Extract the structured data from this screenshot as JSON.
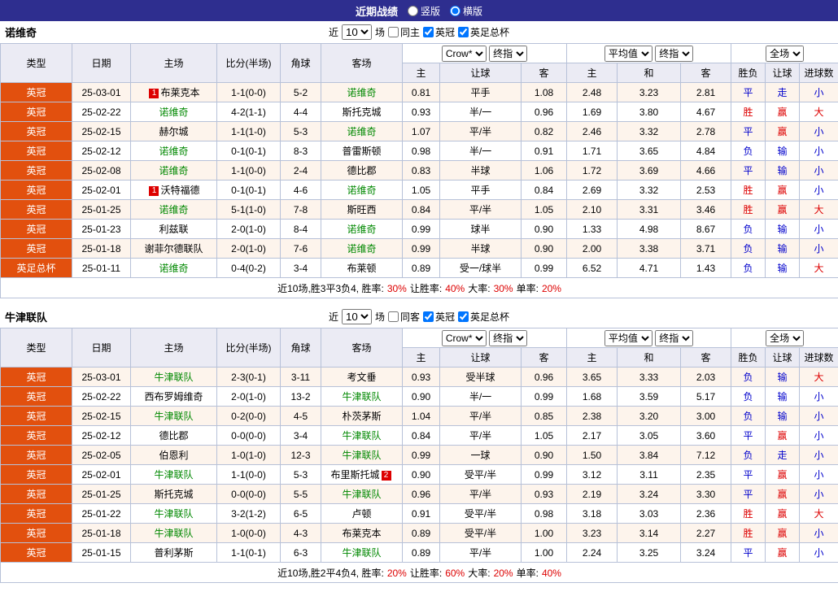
{
  "colors": {
    "header_bar": "#2e2e8f",
    "type_cell": "#e2500e",
    "team_highlight": "#008800",
    "result_red": "#dd0000",
    "result_blue": "#0000cc"
  },
  "topbar": {
    "title": "近期战绩",
    "radio_vertical": "竖版",
    "radio_horizontal": "横版",
    "horizontal_selected": true
  },
  "sections": [
    {
      "team": "诺维奇",
      "filter": {
        "prefix": "近",
        "count": "10",
        "suffix": "场",
        "same_label": "同主",
        "same_checked": false,
        "league1": "英冠",
        "league1_checked": true,
        "league2": "英足总杯",
        "league2_checked": true
      },
      "columns": {
        "type": "类型",
        "date": "日期",
        "home": "主场",
        "score": "比分(半场)",
        "corner": "角球",
        "away": "客场",
        "odds_select1": "Crow*",
        "odds_select2": "终指",
        "avg_select1": "平均值",
        "avg_select2": "终指",
        "full_select": "全场",
        "odds_home": "主",
        "odds_handicap": "让球",
        "odds_away": "客",
        "avg_home": "主",
        "avg_draw": "和",
        "avg_away": "客",
        "result": "胜负",
        "handicap_result": "让球",
        "goals": "进球数"
      },
      "rows": [
        {
          "type": "英冠",
          "date": "25-03-01",
          "home": "布莱克本",
          "home_badge": "1",
          "home_is_team": false,
          "score": "1-1(0-0)",
          "corner": "5-2",
          "away": "诺维奇",
          "away_badge": "",
          "away_is_team": true,
          "odds": [
            "0.81",
            "平手",
            "1.08"
          ],
          "avg": [
            "2.48",
            "3.23",
            "2.81"
          ],
          "results": [
            "平",
            "走",
            "小"
          ]
        },
        {
          "type": "英冠",
          "date": "25-02-22",
          "home": "诺维奇",
          "home_badge": "",
          "home_is_team": true,
          "score": "4-2(1-1)",
          "corner": "4-4",
          "away": "斯托克城",
          "away_badge": "",
          "away_is_team": false,
          "odds": [
            "0.93",
            "半/一",
            "0.96"
          ],
          "avg": [
            "1.69",
            "3.80",
            "4.67"
          ],
          "results": [
            "胜",
            "赢",
            "大"
          ]
        },
        {
          "type": "英冠",
          "date": "25-02-15",
          "home": "赫尔城",
          "home_badge": "",
          "home_is_team": false,
          "score": "1-1(1-0)",
          "corner": "5-3",
          "away": "诺维奇",
          "away_badge": "",
          "away_is_team": true,
          "odds": [
            "1.07",
            "平/半",
            "0.82"
          ],
          "avg": [
            "2.46",
            "3.32",
            "2.78"
          ],
          "results": [
            "平",
            "赢",
            "小"
          ]
        },
        {
          "type": "英冠",
          "date": "25-02-12",
          "home": "诺维奇",
          "home_badge": "",
          "home_is_team": true,
          "score": "0-1(0-1)",
          "corner": "8-3",
          "away": "普雷斯顿",
          "away_badge": "",
          "away_is_team": false,
          "odds": [
            "0.98",
            "半/一",
            "0.91"
          ],
          "avg": [
            "1.71",
            "3.65",
            "4.84"
          ],
          "results": [
            "负",
            "输",
            "小"
          ]
        },
        {
          "type": "英冠",
          "date": "25-02-08",
          "home": "诺维奇",
          "home_badge": "",
          "home_is_team": true,
          "score": "1-1(0-0)",
          "corner": "2-4",
          "away": "德比郡",
          "away_badge": "",
          "away_is_team": false,
          "odds": [
            "0.83",
            "半球",
            "1.06"
          ],
          "avg": [
            "1.72",
            "3.69",
            "4.66"
          ],
          "results": [
            "平",
            "输",
            "小"
          ]
        },
        {
          "type": "英冠",
          "date": "25-02-01",
          "home": "沃特福德",
          "home_badge": "1",
          "home_is_team": false,
          "score": "0-1(0-1)",
          "corner": "4-6",
          "away": "诺维奇",
          "away_badge": "",
          "away_is_team": true,
          "odds": [
            "1.05",
            "平手",
            "0.84"
          ],
          "avg": [
            "2.69",
            "3.32",
            "2.53"
          ],
          "results": [
            "胜",
            "赢",
            "小"
          ]
        },
        {
          "type": "英冠",
          "date": "25-01-25",
          "home": "诺维奇",
          "home_badge": "",
          "home_is_team": true,
          "score": "5-1(1-0)",
          "corner": "7-8",
          "away": "斯旺西",
          "away_badge": "",
          "away_is_team": false,
          "odds": [
            "0.84",
            "平/半",
            "1.05"
          ],
          "avg": [
            "2.10",
            "3.31",
            "3.46"
          ],
          "results": [
            "胜",
            "赢",
            "大"
          ]
        },
        {
          "type": "英冠",
          "date": "25-01-23",
          "home": "利兹联",
          "home_badge": "",
          "home_is_team": false,
          "score": "2-0(1-0)",
          "corner": "8-4",
          "away": "诺维奇",
          "away_badge": "",
          "away_is_team": true,
          "odds": [
            "0.99",
            "球半",
            "0.90"
          ],
          "avg": [
            "1.33",
            "4.98",
            "8.67"
          ],
          "results": [
            "负",
            "输",
            "小"
          ]
        },
        {
          "type": "英冠",
          "date": "25-01-18",
          "home": "谢菲尔德联队",
          "home_badge": "",
          "home_is_team": false,
          "score": "2-0(1-0)",
          "corner": "7-6",
          "away": "诺维奇",
          "away_badge": "",
          "away_is_team": true,
          "odds": [
            "0.99",
            "半球",
            "0.90"
          ],
          "avg": [
            "2.00",
            "3.38",
            "3.71"
          ],
          "results": [
            "负",
            "输",
            "小"
          ]
        },
        {
          "type": "英足总杯",
          "date": "25-01-11",
          "home": "诺维奇",
          "home_badge": "",
          "home_is_team": true,
          "score": "0-4(0-2)",
          "corner": "3-4",
          "away": "布莱顿",
          "away_badge": "",
          "away_is_team": false,
          "odds": [
            "0.89",
            "受一/球半",
            "0.99"
          ],
          "avg": [
            "6.52",
            "4.71",
            "1.43"
          ],
          "results": [
            "负",
            "输",
            "大"
          ]
        }
      ],
      "summary": [
        {
          "text": "近10场,胜3平3负4, 胜率:",
          "red": false
        },
        {
          "text": "30%",
          "red": true
        },
        {
          "text": "让胜率:",
          "red": false
        },
        {
          "text": "40%",
          "red": true
        },
        {
          "text": "大率:",
          "red": false
        },
        {
          "text": "30%",
          "red": true
        },
        {
          "text": "单率:",
          "red": false
        },
        {
          "text": "20%",
          "red": true
        }
      ]
    },
    {
      "team": "牛津联队",
      "filter": {
        "prefix": "近",
        "count": "10",
        "suffix": "场",
        "same_label": "同客",
        "same_checked": false,
        "league1": "英冠",
        "league1_checked": true,
        "league2": "英足总杯",
        "league2_checked": true
      },
      "columns": {
        "type": "类型",
        "date": "日期",
        "home": "主场",
        "score": "比分(半场)",
        "corner": "角球",
        "away": "客场",
        "odds_select1": "Crow*",
        "odds_select2": "终指",
        "avg_select1": "平均值",
        "avg_select2": "终指",
        "full_select": "全场",
        "odds_home": "主",
        "odds_handicap": "让球",
        "odds_away": "客",
        "avg_home": "主",
        "avg_draw": "和",
        "avg_away": "客",
        "result": "胜负",
        "handicap_result": "让球",
        "goals": "进球数"
      },
      "rows": [
        {
          "type": "英冠",
          "date": "25-03-01",
          "home": "牛津联队",
          "home_badge": "",
          "home_is_team": true,
          "score": "2-3(0-1)",
          "corner": "3-11",
          "away": "考文垂",
          "away_badge": "",
          "away_is_team": false,
          "odds": [
            "0.93",
            "受半球",
            "0.96"
          ],
          "avg": [
            "3.65",
            "3.33",
            "2.03"
          ],
          "results": [
            "负",
            "输",
            "大"
          ]
        },
        {
          "type": "英冠",
          "date": "25-02-22",
          "home": "西布罗姆维奇",
          "home_badge": "",
          "home_is_team": false,
          "score": "2-0(1-0)",
          "corner": "13-2",
          "away": "牛津联队",
          "away_badge": "",
          "away_is_team": true,
          "odds": [
            "0.90",
            "半/一",
            "0.99"
          ],
          "avg": [
            "1.68",
            "3.59",
            "5.17"
          ],
          "results": [
            "负",
            "输",
            "小"
          ]
        },
        {
          "type": "英冠",
          "date": "25-02-15",
          "home": "牛津联队",
          "home_badge": "",
          "home_is_team": true,
          "score": "0-2(0-0)",
          "corner": "4-5",
          "away": "朴茨茅斯",
          "away_badge": "",
          "away_is_team": false,
          "odds": [
            "1.04",
            "平/半",
            "0.85"
          ],
          "avg": [
            "2.38",
            "3.20",
            "3.00"
          ],
          "results": [
            "负",
            "输",
            "小"
          ]
        },
        {
          "type": "英冠",
          "date": "25-02-12",
          "home": "德比郡",
          "home_badge": "",
          "home_is_team": false,
          "score": "0-0(0-0)",
          "corner": "3-4",
          "away": "牛津联队",
          "away_badge": "",
          "away_is_team": true,
          "odds": [
            "0.84",
            "平/半",
            "1.05"
          ],
          "avg": [
            "2.17",
            "3.05",
            "3.60"
          ],
          "results": [
            "平",
            "赢",
            "小"
          ]
        },
        {
          "type": "英冠",
          "date": "25-02-05",
          "home": "伯恩利",
          "home_badge": "",
          "home_is_team": false,
          "score": "1-0(1-0)",
          "corner": "12-3",
          "away": "牛津联队",
          "away_badge": "",
          "away_is_team": true,
          "odds": [
            "0.99",
            "一球",
            "0.90"
          ],
          "avg": [
            "1.50",
            "3.84",
            "7.12"
          ],
          "results": [
            "负",
            "走",
            "小"
          ]
        },
        {
          "type": "英冠",
          "date": "25-02-01",
          "home": "牛津联队",
          "home_badge": "",
          "home_is_team": true,
          "score": "1-1(0-0)",
          "corner": "5-3",
          "away": "布里斯托城",
          "away_badge": "2",
          "away_is_team": false,
          "odds": [
            "0.90",
            "受平/半",
            "0.99"
          ],
          "avg": [
            "3.12",
            "3.11",
            "2.35"
          ],
          "results": [
            "平",
            "赢",
            "小"
          ]
        },
        {
          "type": "英冠",
          "date": "25-01-25",
          "home": "斯托克城",
          "home_badge": "",
          "home_is_team": false,
          "score": "0-0(0-0)",
          "corner": "5-5",
          "away": "牛津联队",
          "away_badge": "",
          "away_is_team": true,
          "odds": [
            "0.96",
            "平/半",
            "0.93"
          ],
          "avg": [
            "2.19",
            "3.24",
            "3.30"
          ],
          "results": [
            "平",
            "赢",
            "小"
          ]
        },
        {
          "type": "英冠",
          "date": "25-01-22",
          "home": "牛津联队",
          "home_badge": "",
          "home_is_team": true,
          "score": "3-2(1-2)",
          "corner": "6-5",
          "away": "卢顿",
          "away_badge": "",
          "away_is_team": false,
          "odds": [
            "0.91",
            "受平/半",
            "0.98"
          ],
          "avg": [
            "3.18",
            "3.03",
            "2.36"
          ],
          "results": [
            "胜",
            "赢",
            "大"
          ]
        },
        {
          "type": "英冠",
          "date": "25-01-18",
          "home": "牛津联队",
          "home_badge": "",
          "home_is_team": true,
          "score": "1-0(0-0)",
          "corner": "4-3",
          "away": "布莱克本",
          "away_badge": "",
          "away_is_team": false,
          "odds": [
            "0.89",
            "受平/半",
            "1.00"
          ],
          "avg": [
            "3.23",
            "3.14",
            "2.27"
          ],
          "results": [
            "胜",
            "赢",
            "小"
          ]
        },
        {
          "type": "英冠",
          "date": "25-01-15",
          "home": "普利茅斯",
          "home_badge": "",
          "home_is_team": false,
          "score": "1-1(0-1)",
          "corner": "6-3",
          "away": "牛津联队",
          "away_badge": "",
          "away_is_team": true,
          "odds": [
            "0.89",
            "平/半",
            "1.00"
          ],
          "avg": [
            "2.24",
            "3.25",
            "3.24"
          ],
          "results": [
            "平",
            "赢",
            "小"
          ]
        }
      ],
      "summary": [
        {
          "text": "近10场,胜2平4负4, 胜率:",
          "red": false
        },
        {
          "text": "20%",
          "red": true
        },
        {
          "text": "让胜率:",
          "red": false
        },
        {
          "text": "60%",
          "red": true
        },
        {
          "text": "大率:",
          "red": false
        },
        {
          "text": "20%",
          "red": true
        },
        {
          "text": "单率:",
          "red": false
        },
        {
          "text": "40%",
          "red": true
        }
      ]
    }
  ]
}
